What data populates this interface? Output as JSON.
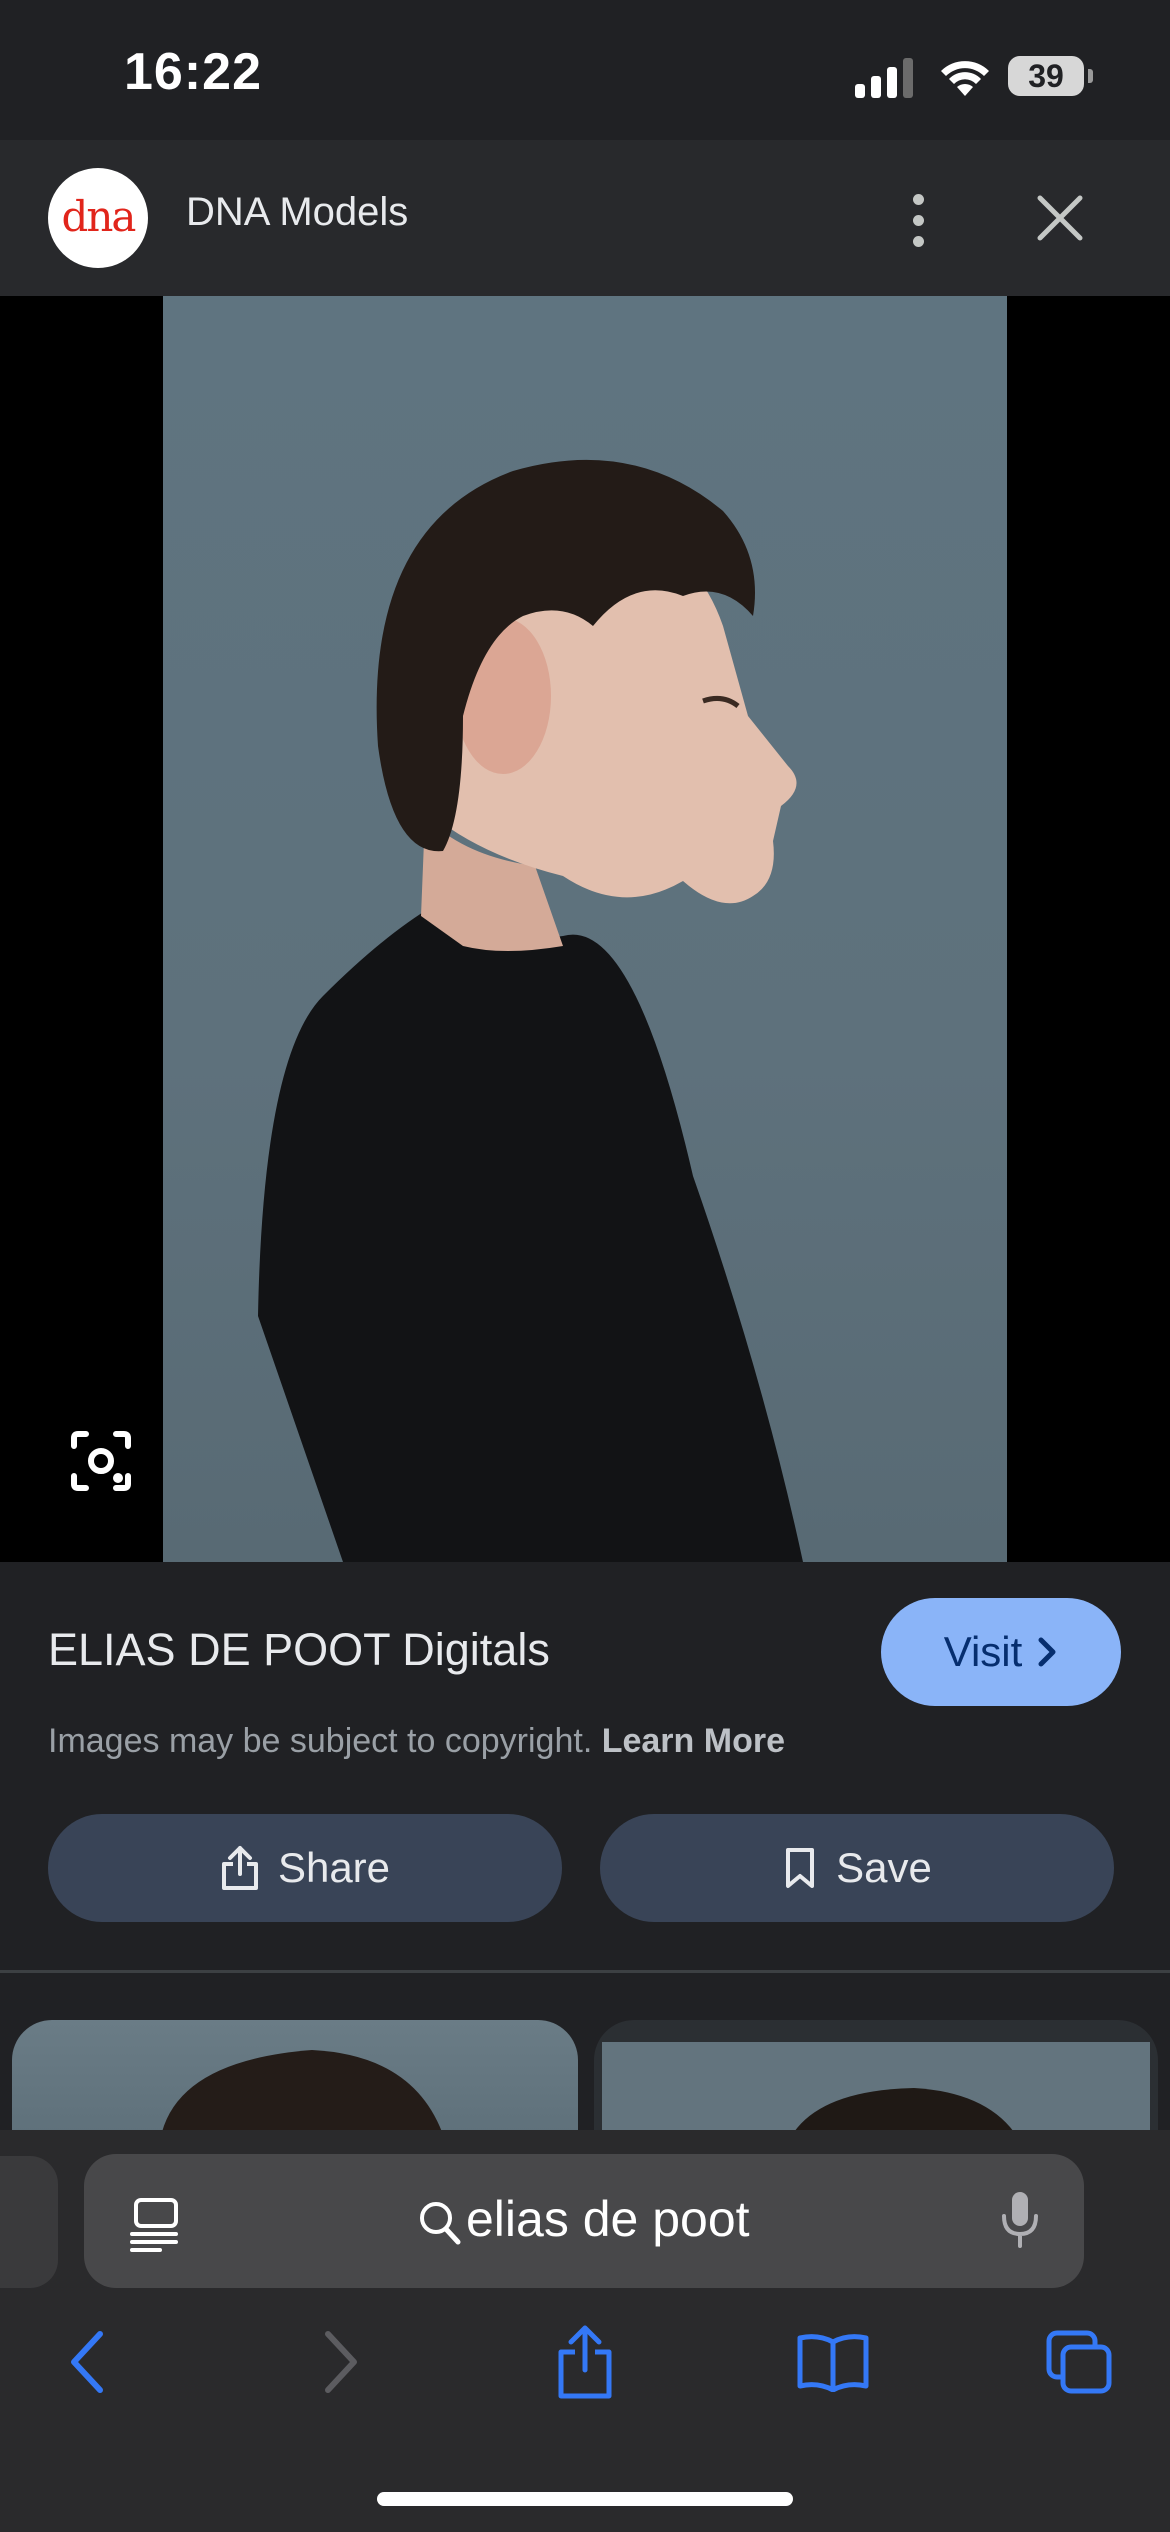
{
  "status_bar": {
    "time": "16:22",
    "battery": "39"
  },
  "header": {
    "logo_text": "dna",
    "site_name": "DNA Models"
  },
  "result": {
    "title": "ELIAS DE POOT Digitals",
    "visit_label": "Visit",
    "copyright_text": "Images may be subject to copyright.",
    "learn_more": "Learn More",
    "share_label": "Share",
    "save_label": "Save"
  },
  "address_bar": {
    "query": "elias de poot"
  },
  "colors": {
    "accent": "#8ab4f8",
    "pill_bg": "#394457",
    "background": "#202124",
    "safari_blue": "#3478f6"
  },
  "icons": [
    "signal-icon",
    "wifi-icon",
    "more-vert-icon",
    "close-icon",
    "lens-icon",
    "chevron-right-icon",
    "share-icon",
    "bookmark-icon",
    "reader-icon",
    "search-icon",
    "mic-icon",
    "back-icon",
    "forward-icon",
    "safari-share-icon",
    "book-icon",
    "tabs-icon"
  ]
}
